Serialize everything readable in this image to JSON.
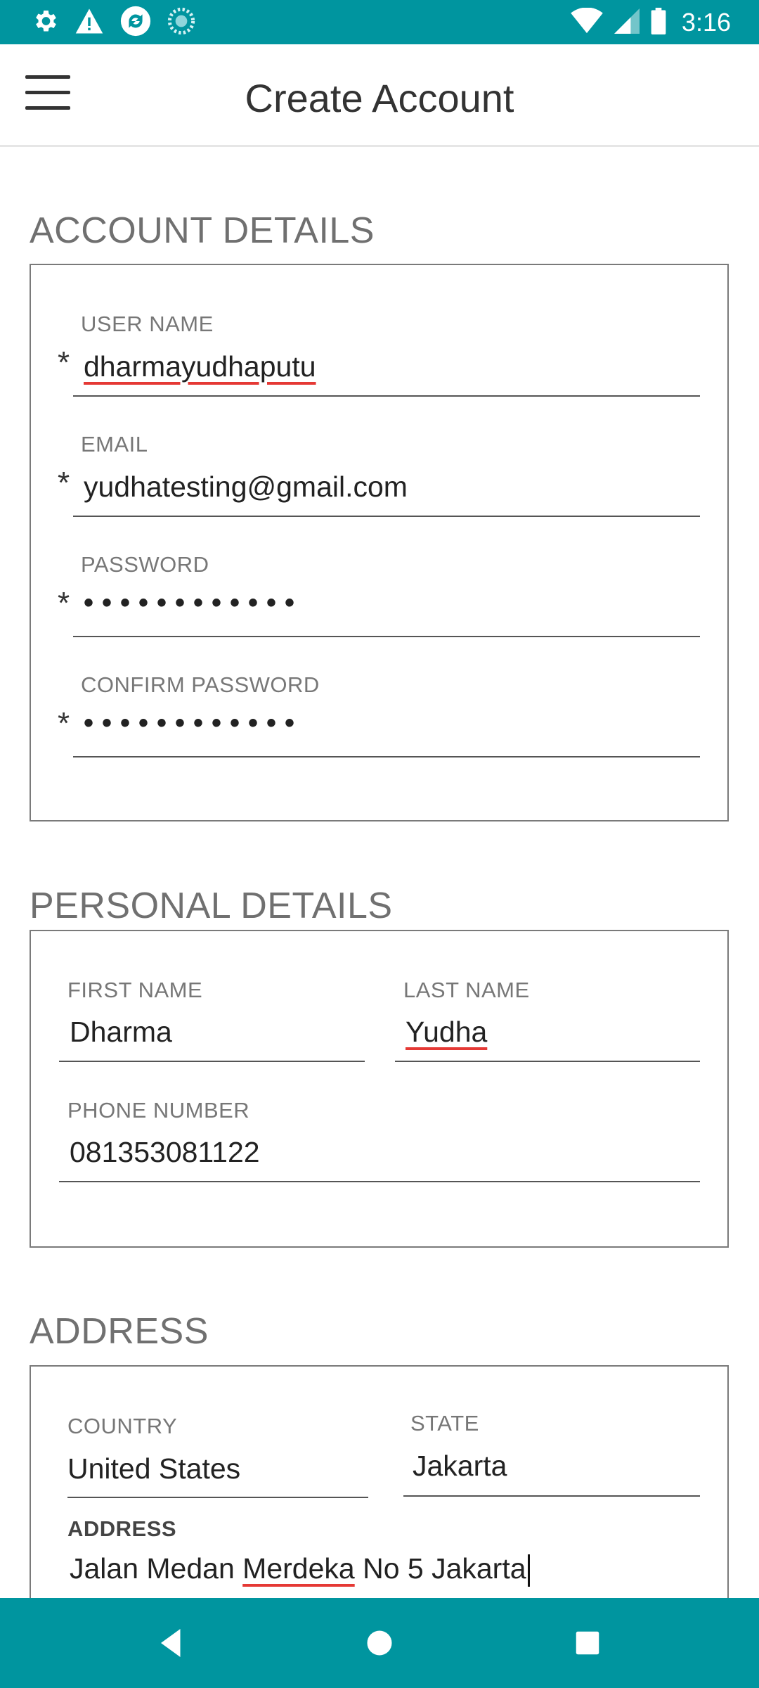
{
  "status_bar": {
    "time": "3:16",
    "left_icons": [
      "gear-icon",
      "warning-icon",
      "sync-icon",
      "loading-icon"
    ],
    "right_icons": [
      "wifi-icon",
      "signal-icon",
      "battery-icon"
    ]
  },
  "app_bar": {
    "title": "Create Account",
    "menu_icon": "hamburger-menu-icon"
  },
  "account_details": {
    "title": "ACCOUNT DETAILS",
    "username": {
      "label": "USER NAME",
      "value": "dharmayudhaputu",
      "required": "*"
    },
    "email": {
      "label": "EMAIL",
      "value": "yudhatesting@gmail.com",
      "required": "*"
    },
    "password": {
      "label": "PASSWORD",
      "value": "••••••••••••",
      "required": "*"
    },
    "confirm_password": {
      "label": "CONFIRM PASSWORD",
      "value": "••••••••••••",
      "required": "*"
    }
  },
  "personal_details": {
    "title": "PERSONAL DETAILS",
    "first_name": {
      "label": "FIRST NAME",
      "value": "Dharma"
    },
    "last_name": {
      "label": "LAST NAME",
      "value": "Yudha"
    },
    "phone": {
      "label": "PHONE NUMBER",
      "value": "081353081122"
    }
  },
  "address": {
    "title": "ADDRESS",
    "country": {
      "label": "COUNTRY",
      "value": "United States"
    },
    "state": {
      "label": "STATE",
      "value": "Jakarta"
    },
    "address": {
      "label": "ADDRESS",
      "value_part1": "Jalan Medan ",
      "value_part2": "Merdeka",
      "value_part3": " No 5 Jakarta"
    }
  },
  "nav_bar": {
    "icons": [
      "back-icon",
      "home-icon",
      "recents-icon"
    ]
  },
  "colors": {
    "accent": "#00959f",
    "label": "#777777",
    "section_title": "#707070",
    "spellcheck": "#e53935"
  }
}
